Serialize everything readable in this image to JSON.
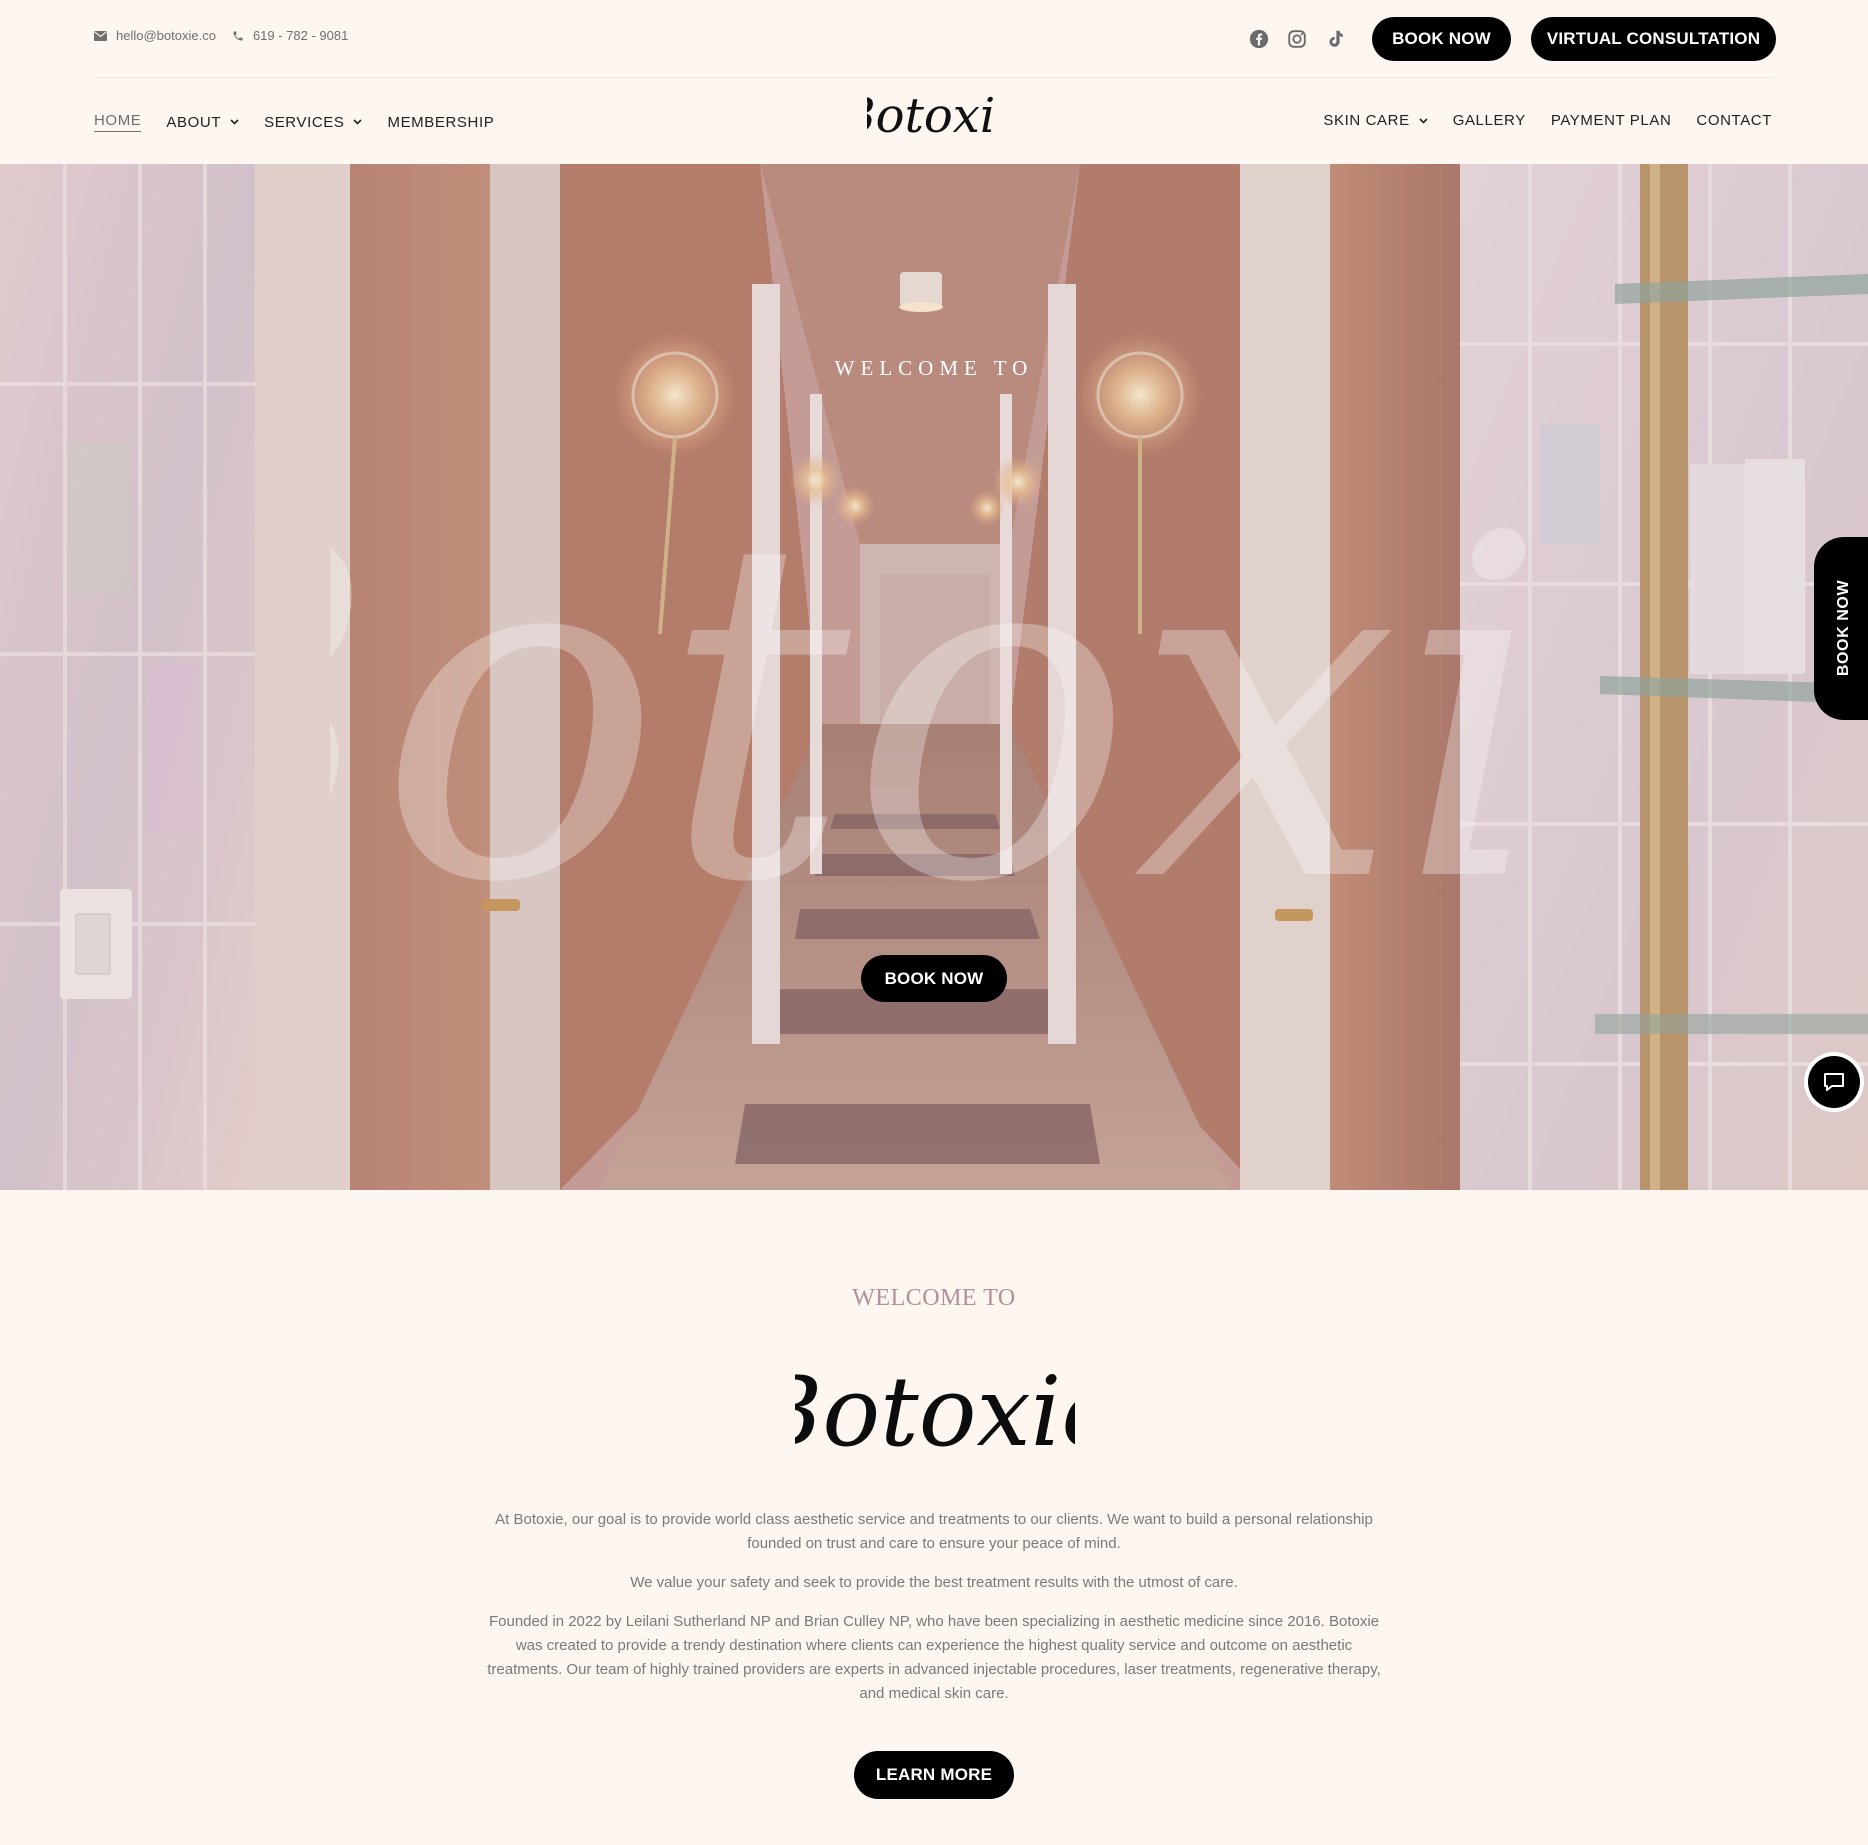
{
  "contact": {
    "email": "hello@botoxie.co",
    "phone": "619 - 782 - 9081"
  },
  "social": [
    "facebook-icon",
    "instagram-icon",
    "tiktok-icon"
  ],
  "header_buttons": {
    "book_now": "BOOK NOW",
    "virtual_consultation": "VIRTUAL CONSULTATION"
  },
  "nav_left": [
    {
      "label": "HOME",
      "active": true,
      "dropdown": false
    },
    {
      "label": "ABOUT",
      "dropdown": true
    },
    {
      "label": "SERVICES",
      "dropdown": true
    },
    {
      "label": "MEMBERSHIP",
      "dropdown": false
    }
  ],
  "nav_right": [
    {
      "label": "SKIN CARE",
      "dropdown": true
    },
    {
      "label": "GALLERY",
      "dropdown": false
    },
    {
      "label": "PAYMENT PLAN",
      "dropdown": false
    },
    {
      "label": "CONTACT",
      "dropdown": false
    }
  ],
  "logo_text": "Botoxie",
  "hero": {
    "welcome": "WELCOME TO",
    "script": "Botoxie",
    "book_now": "BOOK NOW"
  },
  "side_tab": "BOOK NOW",
  "welcome_section": {
    "heading": "WELCOME TO",
    "logo": "Botoxie",
    "paragraphs": [
      "At Botoxie, our goal is to provide world class aesthetic service and treatments to our clients. We want to build a personal relationship founded on trust and care to ensure your peace of mind.",
      "We value your safety and seek to provide the best treatment results with the utmost of care.",
      "Founded in 2022 by Leilani Sutherland NP and Brian Culley NP, who have been specializing in aesthetic medicine since 2016. Botoxie was created to provide a trendy destination where clients can experience the highest quality service and outcome on aesthetic treatments. Our team of highly trained providers are experts in advanced injectable procedures, laser treatments, regenerative therapy, and medical skin care."
    ],
    "learn_more": "LEARN MORE"
  },
  "colors": {
    "background": "#fdf6f1",
    "button": "#000000",
    "accent_heading": "#b58e9c"
  }
}
